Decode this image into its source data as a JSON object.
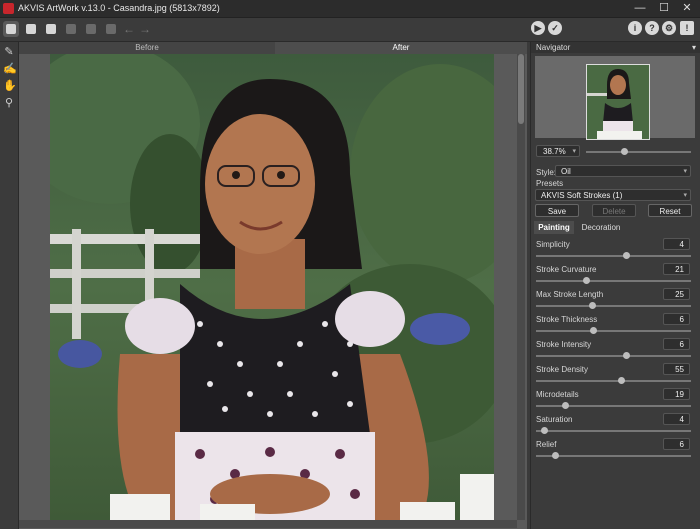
{
  "window": {
    "title": "AKVIS ArtWork v.13.0 - Casandra.jpg (5813x7892)"
  },
  "tabs": {
    "before": "Before",
    "after": "After"
  },
  "navigator": {
    "title": "Navigator",
    "zoom": "38.7%"
  },
  "style": {
    "label": "Style:",
    "value": "Oil"
  },
  "presets": {
    "label": "Presets",
    "value": "AKVIS Soft Strokes (1)",
    "save": "Save",
    "delete": "Delete",
    "reset": "Reset"
  },
  "panel_tabs": {
    "painting": "Painting",
    "decoration": "Decoration"
  },
  "params": [
    {
      "label": "Simplicity",
      "value": "4",
      "fraction": 0.58
    },
    {
      "label": "Stroke Curvature",
      "value": "21",
      "fraction": 0.32
    },
    {
      "label": "Max Stroke Length",
      "value": "25",
      "fraction": 0.36
    },
    {
      "label": "Stroke Thickness",
      "value": "6",
      "fraction": 0.37
    },
    {
      "label": "Stroke Intensity",
      "value": "6",
      "fraction": 0.58
    },
    {
      "label": "Stroke Density",
      "value": "55",
      "fraction": 0.55
    },
    {
      "label": "Microdetails",
      "value": "19",
      "fraction": 0.19
    },
    {
      "label": "Saturation",
      "value": "4",
      "fraction": 0.05
    },
    {
      "label": "Relief",
      "value": "6",
      "fraction": 0.12
    }
  ],
  "colors": {
    "accent": "#c8262c",
    "background": "#3b3b3b"
  }
}
